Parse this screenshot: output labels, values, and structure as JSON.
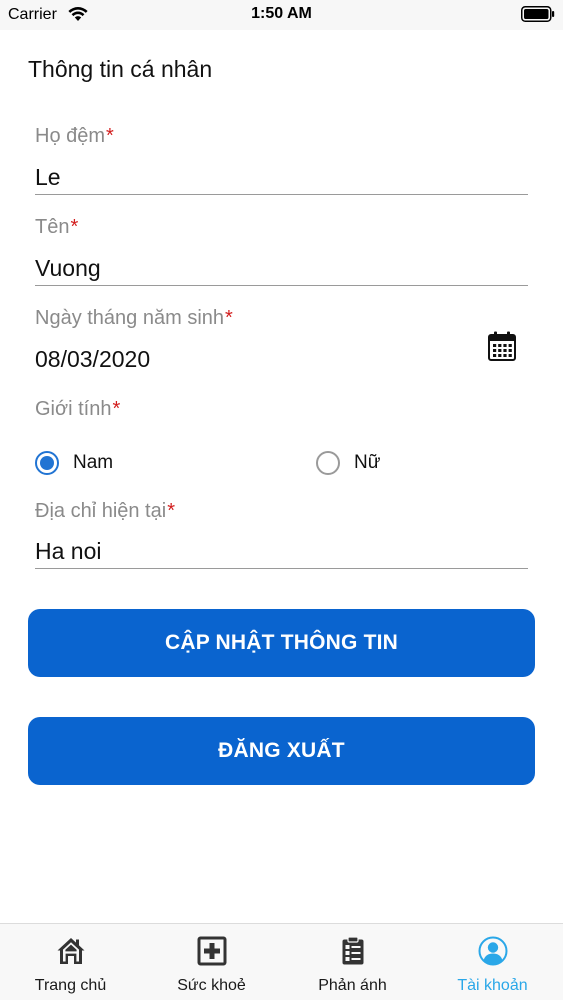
{
  "status_bar": {
    "carrier": "Carrier",
    "time": "1:50 AM"
  },
  "page": {
    "title": "Thông tin cá nhân"
  },
  "form": {
    "required_marker": "*",
    "last_name": {
      "label": "Họ đệm",
      "value": "Le"
    },
    "first_name": {
      "label": "Tên",
      "value": "Vuong"
    },
    "birth_date": {
      "label": "Ngày tháng năm sinh",
      "value": "08/03/2020"
    },
    "gender": {
      "label": "Giới tính",
      "options": [
        {
          "label": "Nam",
          "selected": true
        },
        {
          "label": "Nữ",
          "selected": false
        }
      ]
    },
    "address": {
      "label": "Địa chỉ hiện tại",
      "value": "Ha noi"
    }
  },
  "buttons": {
    "update": "CẬP NHẬT THÔNG TIN",
    "logout": "ĐĂNG XUẤT"
  },
  "tab_bar": {
    "items": [
      {
        "label": "Trang chủ",
        "icon": "home-icon",
        "active": false
      },
      {
        "label": "Sức khoẻ",
        "icon": "health-plus-icon",
        "active": false
      },
      {
        "label": "Phản ánh",
        "icon": "clipboard-icon",
        "active": false
      },
      {
        "label": "Tài khoản",
        "icon": "account-icon",
        "active": true
      }
    ]
  },
  "colors": {
    "primary": "#0a64cf",
    "radio_selected": "#2174d3",
    "required": "#d21d1d",
    "tab_active": "#2aa7e8"
  }
}
